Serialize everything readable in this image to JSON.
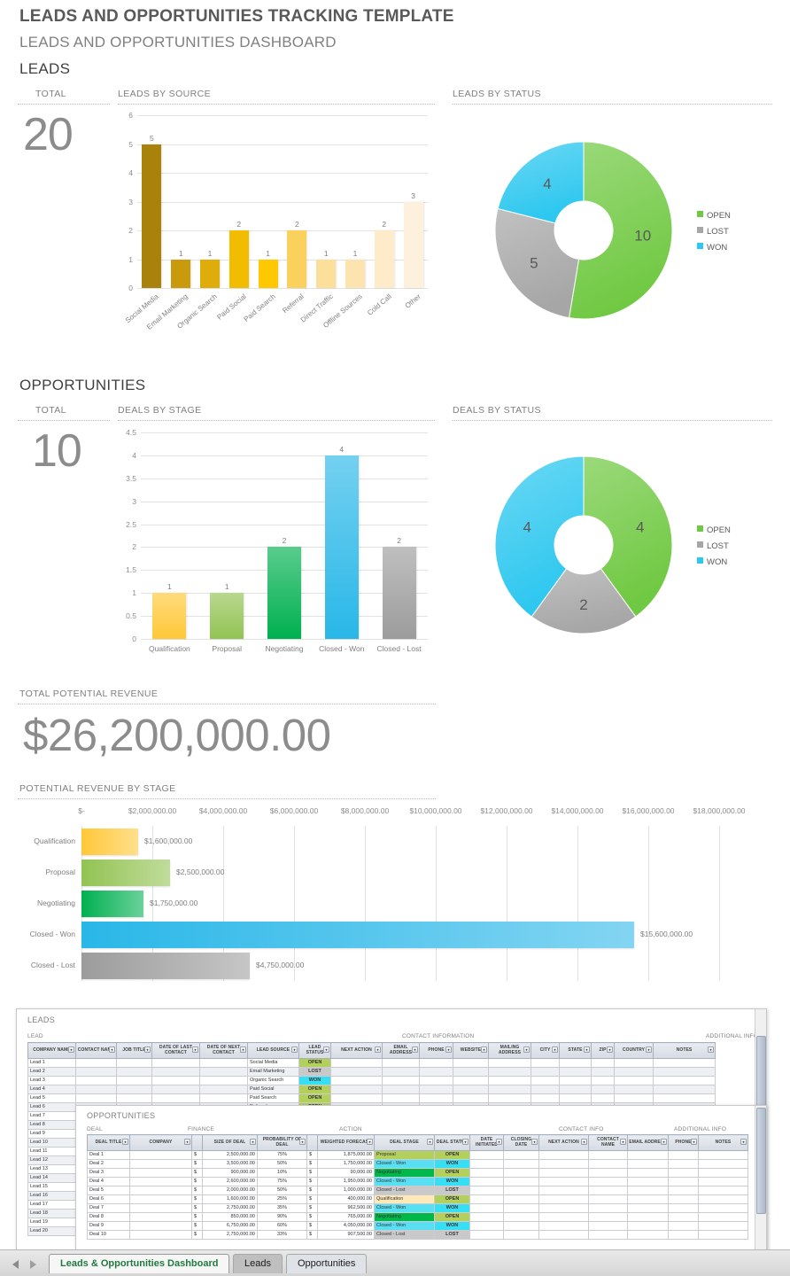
{
  "header": {
    "main_title": "LEADS AND OPPORTUNITIES TRACKING TEMPLATE",
    "sub_title": "LEADS AND OPPORTUNITIES DASHBOARD"
  },
  "sections": {
    "leads": "LEADS",
    "opportunities": "OPPORTUNITIES"
  },
  "leads_total": {
    "label": "TOTAL",
    "value": "20"
  },
  "opps_total": {
    "label": "TOTAL",
    "value": "10"
  },
  "total_revenue": {
    "label": "TOTAL POTENTIAL REVENUE",
    "value": "$26,200,000.00"
  },
  "panels": {
    "leads_by_source": "LEADS BY SOURCE",
    "leads_by_status": "LEADS BY STATUS",
    "deals_by_stage": "DEALS BY STAGE",
    "deals_by_status": "DEALS BY STATUS",
    "revenue_by_stage": "POTENTIAL REVENUE BY STAGE"
  },
  "chart_data": [
    {
      "type": "bar",
      "title": "LEADS BY SOURCE",
      "categories": [
        "Social Media",
        "Email Marketing",
        "Organic Search",
        "Paid Social",
        "Paid Search",
        "Referral",
        "Direct Traffic",
        "Offline Sources",
        "Cold Call",
        "Other"
      ],
      "values": [
        5,
        1,
        1,
        2,
        1,
        2,
        1,
        1,
        2,
        3
      ],
      "colors": [
        "#a8820b",
        "#c99a0c",
        "#dfad0b",
        "#f2bc00",
        "#ffc800",
        "#fbd15e",
        "#fddf9c",
        "#fde3b0",
        "#fdebc9",
        "#fdf0dc"
      ],
      "ylim": [
        0,
        6
      ],
      "yticks": [
        0,
        1,
        2,
        3,
        4,
        5,
        6
      ],
      "xlabel": "",
      "ylabel": "",
      "grid": true
    },
    {
      "type": "pie",
      "title": "LEADS BY STATUS",
      "labels": [
        "OPEN",
        "LOST",
        "WON"
      ],
      "values": [
        10,
        5,
        4
      ],
      "colors": [
        "#70c942",
        "#a6a6a6",
        "#2dc7ef"
      ],
      "legend_position": "right",
      "donut": true
    },
    {
      "type": "bar",
      "title": "DEALS BY STAGE",
      "categories": [
        "Qualification",
        "Proposal",
        "Negotiating",
        "Closed - Won",
        "Closed - Lost"
      ],
      "values": [
        1,
        1,
        2,
        4,
        2
      ],
      "colors": [
        "#ffc838",
        "#92c353",
        "#00b050",
        "#29b7e8",
        "#9c9c9c"
      ],
      "ylim": [
        0,
        4.5
      ],
      "yticks": [
        "0",
        "0.5",
        "1",
        "1.5",
        "2",
        "2.5",
        "3",
        "3.5",
        "4",
        "4.5"
      ],
      "xlabel": "",
      "ylabel": "",
      "grid": true
    },
    {
      "type": "pie",
      "title": "DEALS BY STATUS",
      "labels": [
        "OPEN",
        "LOST",
        "WON"
      ],
      "values": [
        4,
        2,
        4
      ],
      "colors": [
        "#70c942",
        "#a6a6a6",
        "#2dc7ef"
      ],
      "legend_position": "right",
      "donut": true
    },
    {
      "type": "bar",
      "orientation": "horizontal",
      "title": "POTENTIAL REVENUE BY STAGE",
      "categories": [
        "Qualification",
        "Proposal",
        "Negotiating",
        "Closed - Won",
        "Closed - Lost"
      ],
      "values": [
        1600000,
        2500000,
        1750000,
        15600000,
        4750000
      ],
      "value_labels": [
        "$1,600,000.00",
        "$2,500,000.00",
        "$1,750,000.00",
        "$15,600,000.00",
        "$4,750,000.00"
      ],
      "colors": [
        "#ffc838",
        "#92c353",
        "#00b050",
        "#29b7e8",
        "#9c9c9c"
      ],
      "xticks": [
        "$-",
        "$2,000,000.00",
        "$4,000,000.00",
        "$6,000,000.00",
        "$8,000,000.00",
        "$10,000,000.00",
        "$12,000,000.00",
        "$14,000,000.00",
        "$16,000,000.00",
        "$18,000,000.00"
      ],
      "xlim": [
        0,
        18000000
      ],
      "grid": true
    }
  ],
  "leads_sheet": {
    "title": "LEADS",
    "groups": [
      "LEAD",
      "CONTACT INFORMATION",
      "ADDITIONAL INFO"
    ],
    "columns": [
      "COMPANY NAME",
      "CONTACT NAME",
      "JOB TITLE",
      "DATE OF LAST CONTACT",
      "DATE OF NEXT CONTACT",
      "LEAD SOURCE",
      "LEAD STATUS",
      "NEXT ACTION",
      "EMAIL ADDRESS",
      "PHONE",
      "WEBSITE",
      "MAILING ADDRESS",
      "CITY",
      "STATE",
      "ZIP",
      "COUNTRY",
      "NOTES"
    ],
    "rows": [
      {
        "name": "Lead 1",
        "source": "Social Media",
        "status": "OPEN"
      },
      {
        "name": "Lead 2",
        "source": "Email Marketing",
        "status": "LOST"
      },
      {
        "name": "Lead 3",
        "source": "Organic Search",
        "status": "WON"
      },
      {
        "name": "Lead 4",
        "source": "Paid Social",
        "status": "OPEN"
      },
      {
        "name": "Lead 5",
        "source": "Paid Search",
        "status": "OPEN"
      },
      {
        "name": "Lead 6",
        "source": "Referral",
        "status": "OPEN"
      },
      {
        "name": "Lead 7",
        "source": "",
        "status": ""
      },
      {
        "name": "Lead 8",
        "source": "",
        "status": ""
      },
      {
        "name": "Lead 9",
        "source": "",
        "status": ""
      },
      {
        "name": "Lead 10",
        "source": "",
        "status": ""
      },
      {
        "name": "Lead 11",
        "source": "",
        "status": ""
      },
      {
        "name": "Lead 12",
        "source": "",
        "status": ""
      },
      {
        "name": "Lead 13",
        "source": "",
        "status": ""
      },
      {
        "name": "Lead 14",
        "source": "",
        "status": ""
      },
      {
        "name": "Lead 15",
        "source": "",
        "status": ""
      },
      {
        "name": "Lead 16",
        "source": "",
        "status": ""
      },
      {
        "name": "Lead 17",
        "source": "",
        "status": ""
      },
      {
        "name": "Lead 18",
        "source": "",
        "status": ""
      },
      {
        "name": "Lead 19",
        "source": "",
        "status": ""
      },
      {
        "name": "Lead 20",
        "source": "",
        "status": ""
      }
    ]
  },
  "opps_sheet": {
    "title": "OPPORTUNITIES",
    "groups": [
      "DEAL",
      "FINANCE",
      "ACTION",
      "CONTACT INFO",
      "ADDITIONAL INFO"
    ],
    "columns": [
      "DEAL TITLE",
      "COMPANY",
      "SIZE OF DEAL",
      "PROBABILITY OF DEAL",
      "WEIGHTED FORECAST",
      "DEAL STAGE",
      "DEAL STATUS",
      "DATE INITIATED",
      "CLOSING DATE",
      "NEXT ACTION",
      "CONTACT NAME",
      "EMAIL ADDRESS",
      "PHONE",
      "NOTES"
    ],
    "rows": [
      {
        "title": "Deal 1",
        "size": "2,500,000.00",
        "prob": "75%",
        "forecast": "1,875,000.00",
        "stage": "Proposal",
        "status": "OPEN"
      },
      {
        "title": "Deal 2",
        "size": "3,500,000.00",
        "prob": "50%",
        "forecast": "1,750,000.00",
        "stage": "Closed - Won",
        "status": "WON"
      },
      {
        "title": "Deal 3",
        "size": "900,000.00",
        "prob": "10%",
        "forecast": "90,000.00",
        "stage": "Negotiating",
        "status": "OPEN"
      },
      {
        "title": "Deal 4",
        "size": "2,600,000.00",
        "prob": "75%",
        "forecast": "1,950,000.00",
        "stage": "Closed - Won",
        "status": "WON"
      },
      {
        "title": "Deal 5",
        "size": "2,000,000.00",
        "prob": "50%",
        "forecast": "1,000,000.00",
        "stage": "Closed - Lost",
        "status": "LOST"
      },
      {
        "title": "Deal 6",
        "size": "1,600,000.00",
        "prob": "25%",
        "forecast": "400,000.00",
        "stage": "Qualification",
        "status": "OPEN"
      },
      {
        "title": "Deal 7",
        "size": "2,750,000.00",
        "prob": "35%",
        "forecast": "962,500.00",
        "stage": "Closed - Won",
        "status": "WON"
      },
      {
        "title": "Deal 8",
        "size": "850,000.00",
        "prob": "90%",
        "forecast": "765,000.00",
        "stage": "Negotiating",
        "status": "OPEN"
      },
      {
        "title": "Deal 9",
        "size": "6,750,000.00",
        "prob": "60%",
        "forecast": "4,050,000.00",
        "stage": "Closed - Won",
        "status": "WON"
      },
      {
        "title": "Deal 10",
        "size": "2,750,000.00",
        "prob": "33%",
        "forecast": "907,500.00",
        "stage": "Closed - Lost",
        "status": "LOST"
      }
    ],
    "currency_symbol": "$"
  },
  "tabbar": {
    "tabs": [
      {
        "label": "Leads & Opportunities Dashboard",
        "active": true
      },
      {
        "label": "Leads",
        "active": false
      },
      {
        "label": "Opportunities",
        "active": false
      }
    ]
  }
}
